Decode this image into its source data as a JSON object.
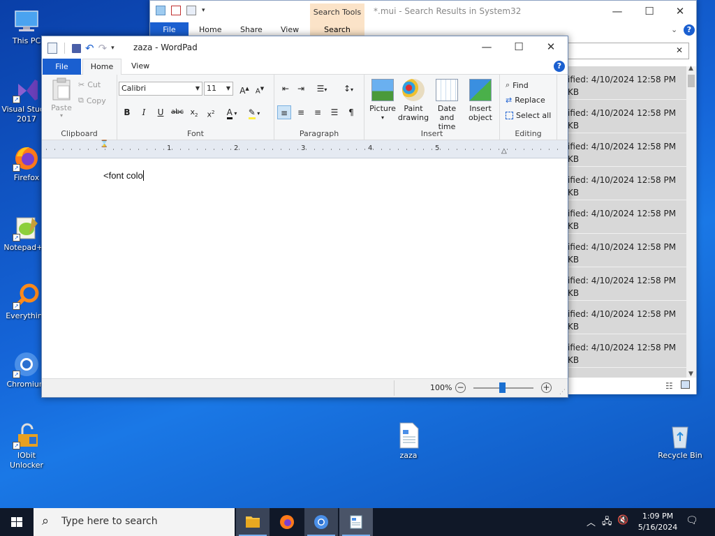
{
  "desktop": {
    "icons": [
      {
        "label": "This PC"
      },
      {
        "label": "Visual Studio 2017"
      },
      {
        "label": "Firefox"
      },
      {
        "label": "Notepad++"
      },
      {
        "label": "Everything"
      },
      {
        "label": "Chromium"
      },
      {
        "label": "IObit Unlocker"
      }
    ],
    "file_icon": {
      "label": "zaza"
    },
    "recycle_bin": {
      "label": "Recycle Bin"
    }
  },
  "explorer": {
    "title": "*.mui - Search Results in System32",
    "context_tab": "Search Tools",
    "tabs": [
      "File",
      "Home",
      "Share",
      "View",
      "Search"
    ],
    "rows": [
      {
        "prefix": "ified:",
        "date": "4/10/2024 12:58 PM",
        "size": "KB"
      },
      {
        "prefix": "ified:",
        "date": "4/10/2024 12:58 PM",
        "size": "KB"
      },
      {
        "prefix": "ified:",
        "date": "4/10/2024 12:58 PM",
        "size": "KB"
      },
      {
        "prefix": "ified:",
        "date": "4/10/2024 12:58 PM",
        "size": "KB"
      },
      {
        "prefix": "ified:",
        "date": "4/10/2024 12:58 PM",
        "size": "KB"
      },
      {
        "prefix": "ified:",
        "date": "4/10/2024 12:58 PM",
        "size": "KB"
      },
      {
        "prefix": "ified:",
        "date": "4/10/2024 12:58 PM",
        "size": "KB"
      },
      {
        "prefix": "ified:",
        "date": "4/10/2024 12:58 PM",
        "size": "KB"
      },
      {
        "prefix": "ified:",
        "date": "4/10/2024 12:58 PM",
        "size": "KB"
      }
    ]
  },
  "wordpad": {
    "title": "zaza - WordPad",
    "tabs": {
      "file": "File",
      "home": "Home",
      "view": "View"
    },
    "clipboard": {
      "paste": "Paste",
      "cut": "Cut",
      "copy": "Copy",
      "label": "Clipboard"
    },
    "font": {
      "family": "Calibri",
      "size": "11",
      "label": "Font"
    },
    "paragraph": {
      "label": "Paragraph"
    },
    "insert": {
      "picture": "Picture",
      "paint_drawing": "Paint drawing",
      "date_time": "Date and time",
      "insert_object": "Insert object",
      "label": "Insert"
    },
    "editing": {
      "find": "Find",
      "replace": "Replace",
      "select_all": "Select all",
      "label": "Editing"
    },
    "ruler_numbers": [
      "1",
      "2",
      "3",
      "4",
      "5"
    ],
    "document_text": "<font colo",
    "zoom": "100%",
    "zoom_level": 1.0
  },
  "taskbar": {
    "search_placeholder": "Type here to search",
    "time": "1:09 PM",
    "date": "5/16/2024"
  }
}
